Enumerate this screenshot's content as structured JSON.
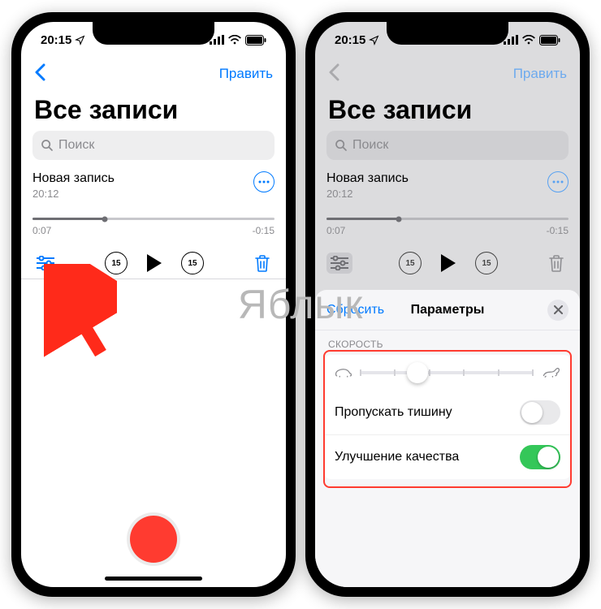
{
  "status": {
    "time": "20:15"
  },
  "nav": {
    "edit_label": "Править"
  },
  "title": "Все записи",
  "search": {
    "placeholder": "Поиск"
  },
  "recording": {
    "name": "Новая запись",
    "time": "20:12",
    "elapsed": "0:07",
    "remaining": "-0:15",
    "skip_seconds": "15"
  },
  "sheet": {
    "reset_label": "Сбросить",
    "title": "Параметры",
    "speed_section": "СКОРОСТЬ",
    "skip_silence": "Пропускать тишину",
    "enhance": "Улучшение качества",
    "skip_silence_on": false,
    "enhance_on": true
  },
  "watermark": "Яблык"
}
